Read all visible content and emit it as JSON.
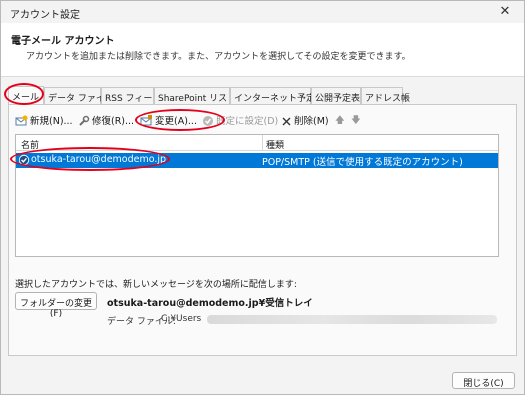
{
  "window": {
    "title": "アカウント設定",
    "close_glyph": "✕"
  },
  "header": {
    "title": "電子メール アカウント",
    "subtitle": "アカウントを追加または削除できます。また、アカウントを選択してその設定を変更できます。"
  },
  "tabs": [
    {
      "label": "メール",
      "active": true
    },
    {
      "label": "データ ファイル"
    },
    {
      "label": "RSS フィード"
    },
    {
      "label": "SharePoint リスト"
    },
    {
      "label": "インターネット予定表"
    },
    {
      "label": "公開予定表"
    },
    {
      "label": "アドレス帳"
    }
  ],
  "toolbar": {
    "new_label": "新規(N)...",
    "repair_label": "修復(R)...",
    "change_label": "変更(A)...",
    "default_label": "既定に設定(D)",
    "delete_label": "削除(M)",
    "up_arrow": "🡅",
    "down_arrow": "🡇"
  },
  "account_list": {
    "col_name": "名前",
    "col_type": "種類",
    "rows": [
      {
        "name": "otsuka-tarou@demodemo.jp",
        "type": "POP/SMTP (送信で使用する既定のアカウント)",
        "selected": true
      }
    ]
  },
  "delivery": {
    "label": "選択したアカウントでは、新しいメッセージを次の場所に配信します:",
    "change_folder_label": "フォルダーの変更(F)",
    "path": "otsuka-tarou@demodemo.jp¥受信トレイ",
    "data_file_label": "データ ファイル:",
    "data_file_path": "C:¥Users"
  },
  "footer": {
    "close_label": "閉じる(C)"
  },
  "colors": {
    "selection": "#0078d7",
    "highlight_ring": "#e3001b"
  }
}
